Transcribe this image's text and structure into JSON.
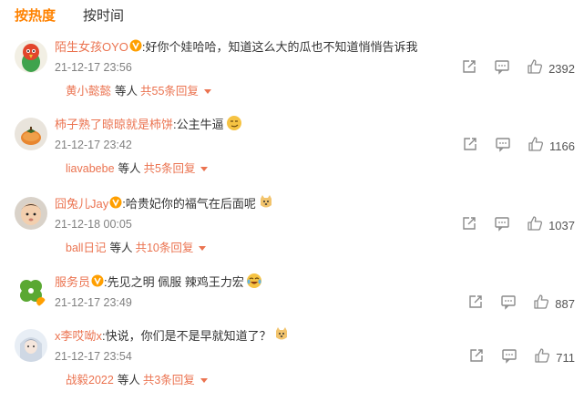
{
  "tabs": [
    {
      "label": "按热度",
      "active": true
    },
    {
      "label": "按时间",
      "active": false
    }
  ],
  "comments": [
    {
      "user": "陌生女孩OYO",
      "text": ":好你个娃哈哈，知道这么大的瓜也不知道悄悄告诉我",
      "time": "21-12-17 23:56",
      "likes": "2392",
      "reply_user": "黄小懿懿",
      "reply_mid": "等人",
      "reply_count": "共55条回复",
      "avatar": "parrot-avatar",
      "emoji": "none"
    },
    {
      "user": "柿子熟了晾晾就是柿饼",
      "text": ":公主牛逼",
      "time": "21-12-17 23:42",
      "likes": "1166",
      "reply_user": "liavabebe",
      "reply_mid": "等人",
      "reply_count": "共5条回复",
      "avatar": "persimmon-avatar",
      "emoji": "smirk-emoji"
    },
    {
      "user": "囧兔儿Jay",
      "text": ":哈贵妃你的福气在后面呢",
      "time": "21-12-18 00:05",
      "likes": "1037",
      "reply_user": "ball日记",
      "reply_mid": "等人",
      "reply_count": "共10条回复",
      "avatar": "baby-avatar",
      "emoji": "doge-emoji"
    },
    {
      "user": "服务员",
      "text": ":先见之明 佩服 辣鸡王力宏",
      "time": "21-12-17 23:49",
      "likes": "887",
      "avatar": "clover-avatar",
      "emoji": "laugh-cry-emoji"
    },
    {
      "user": "x李哎呦x",
      "text": ":快说，你们是不是早就知道了？",
      "time": "21-12-17 23:54",
      "likes": "711",
      "reply_user": "战毅2022",
      "reply_mid": "等人",
      "reply_count": "共3条回复",
      "avatar": "anime-avatar",
      "emoji": "doge-emoji"
    }
  ],
  "colors": {
    "accent": "#ff8200",
    "username": "#eb7350",
    "vip_badge": "#ff9f00",
    "time": "#808080",
    "icon": "#8a8a8a"
  }
}
